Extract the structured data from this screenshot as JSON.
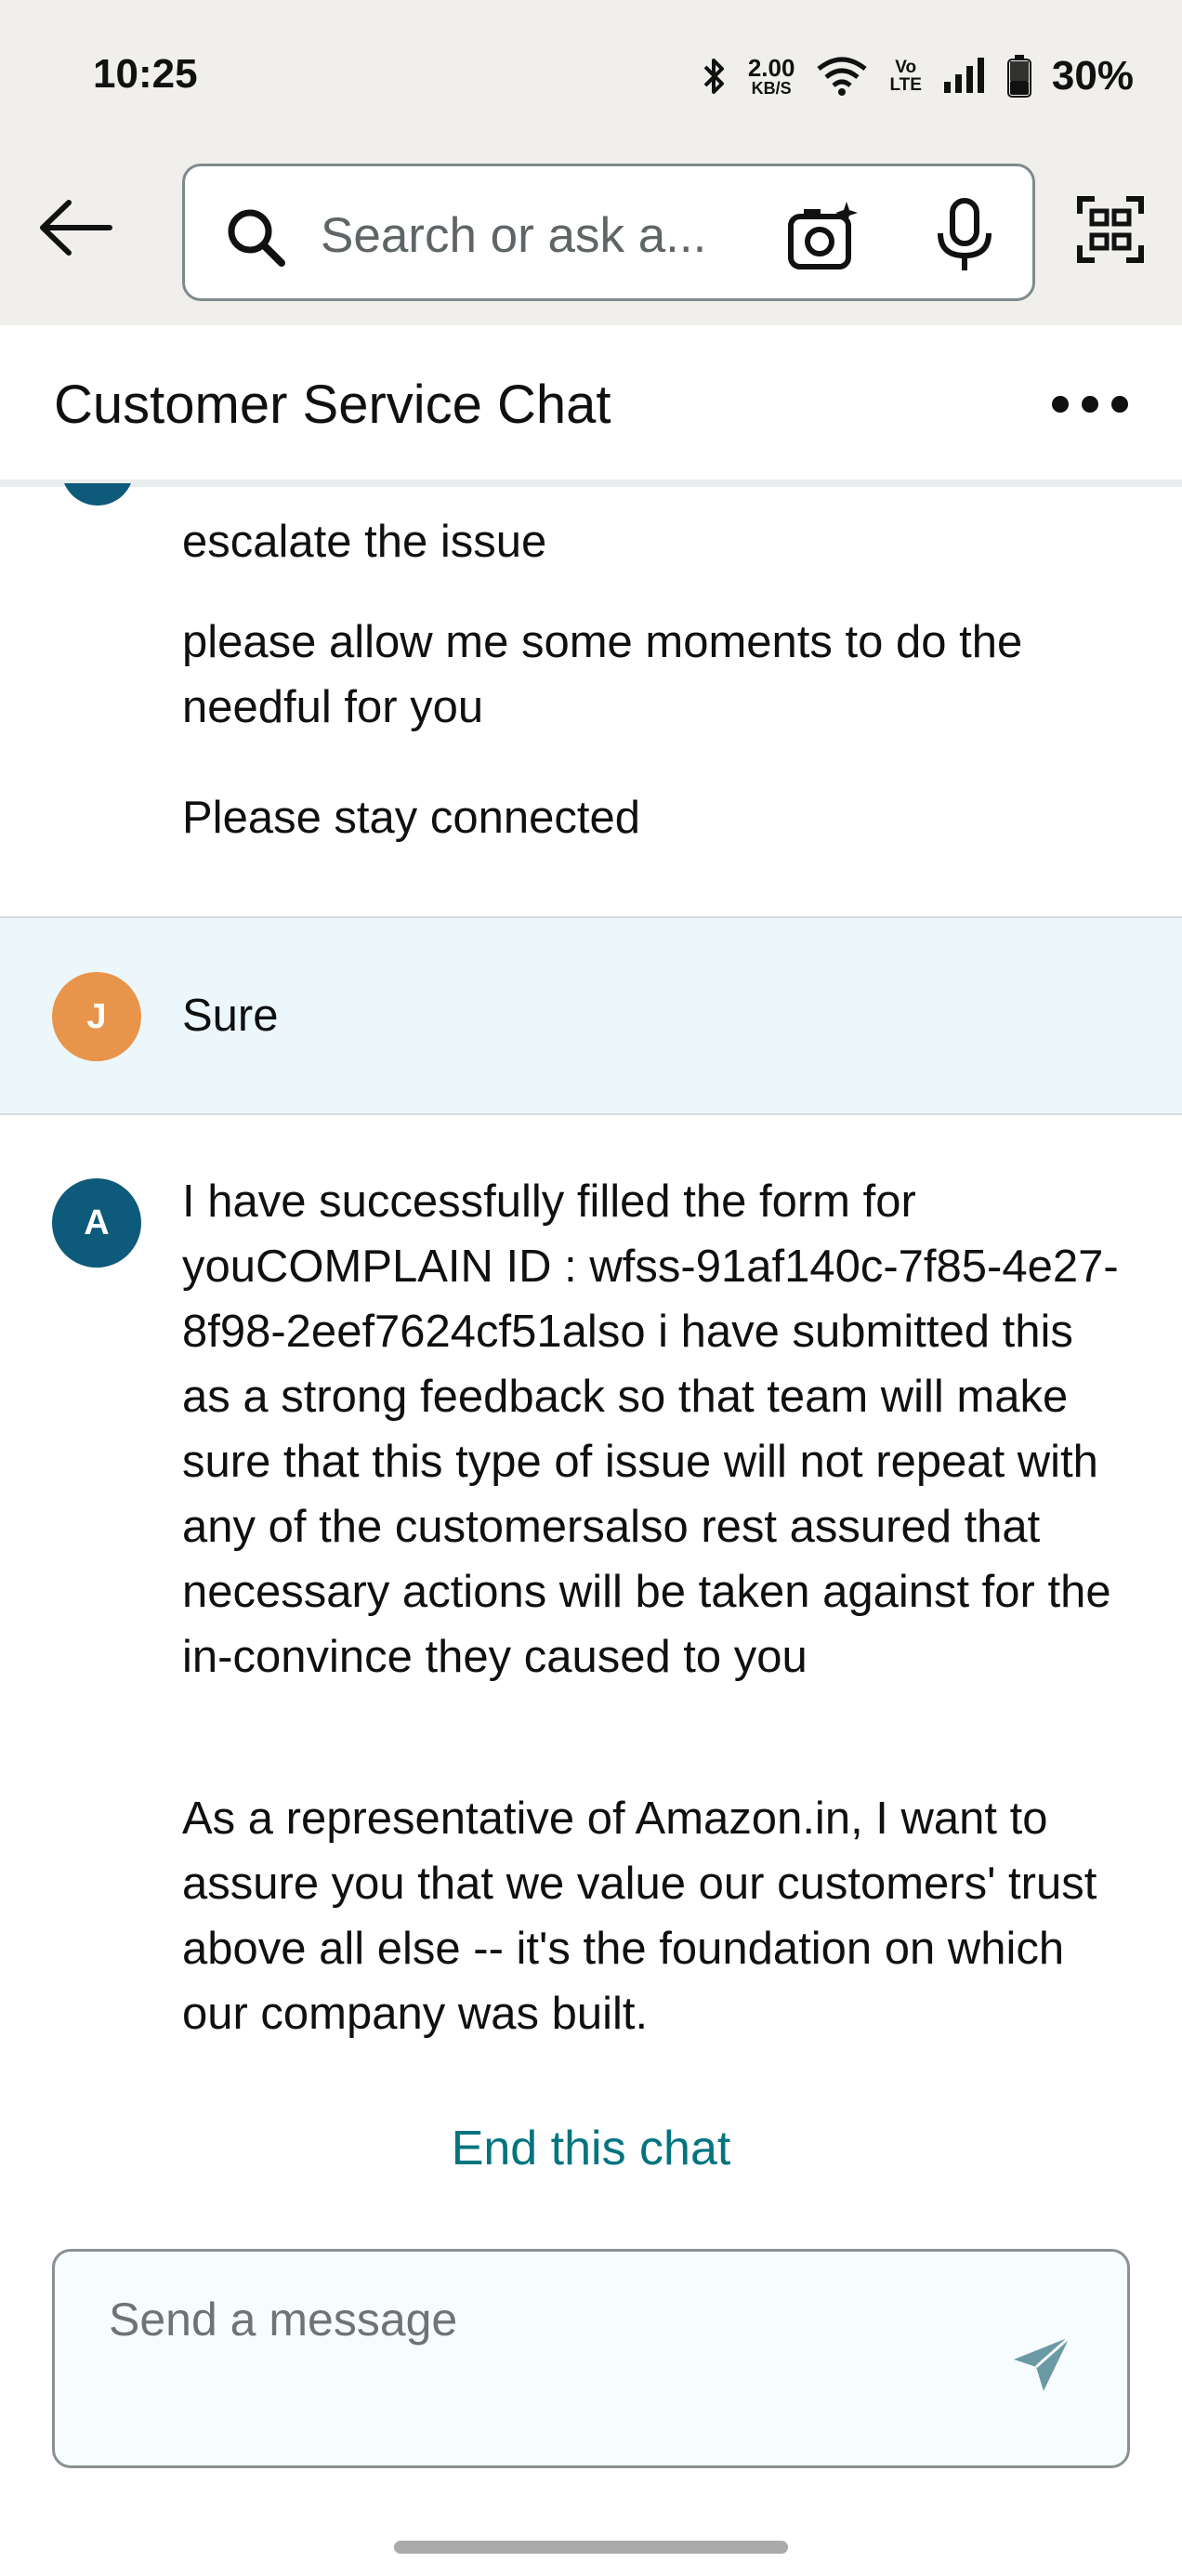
{
  "status_bar": {
    "time": "10:25",
    "net_speed_value": "2.00",
    "net_speed_unit": "KB/S",
    "volte_top": "Vo",
    "volte_bottom": "LTE",
    "battery": "30%"
  },
  "search": {
    "placeholder": "Search or ask a..."
  },
  "header": {
    "title": "Customer Service Chat"
  },
  "messages": {
    "agent_prev_1": "escalate the issue",
    "agent_prev_2": "please allow me some moments to do the needful for you",
    "agent_prev_3": "Please stay connected",
    "user_initial": "J",
    "user_msg": "Sure",
    "agent_initial": "A",
    "agent_msg_1": "I have successfully filled the form for youCOMPLAIN ID : wfss-91af140c-7f85-4e27-8f98-2eef7624cf51also i have submitted this as a strong feedback so that team will make sure that this type of issue will not repeat with any of the customersalso rest assured that necessary actions will be taken against for the in-convince they caused to you",
    "agent_msg_2": "As a representative of Amazon.in, I want to assure you that we value our customers' trust above all else -- it's the foundation on which our company was built."
  },
  "end_chat_label": "End this chat",
  "composer": {
    "placeholder": "Send a message"
  },
  "colors": {
    "accent_link": "#017480",
    "agent_avatar": "#0e5a7a",
    "user_avatar": "#e8944a",
    "user_row_bg": "#ecf7fb"
  }
}
